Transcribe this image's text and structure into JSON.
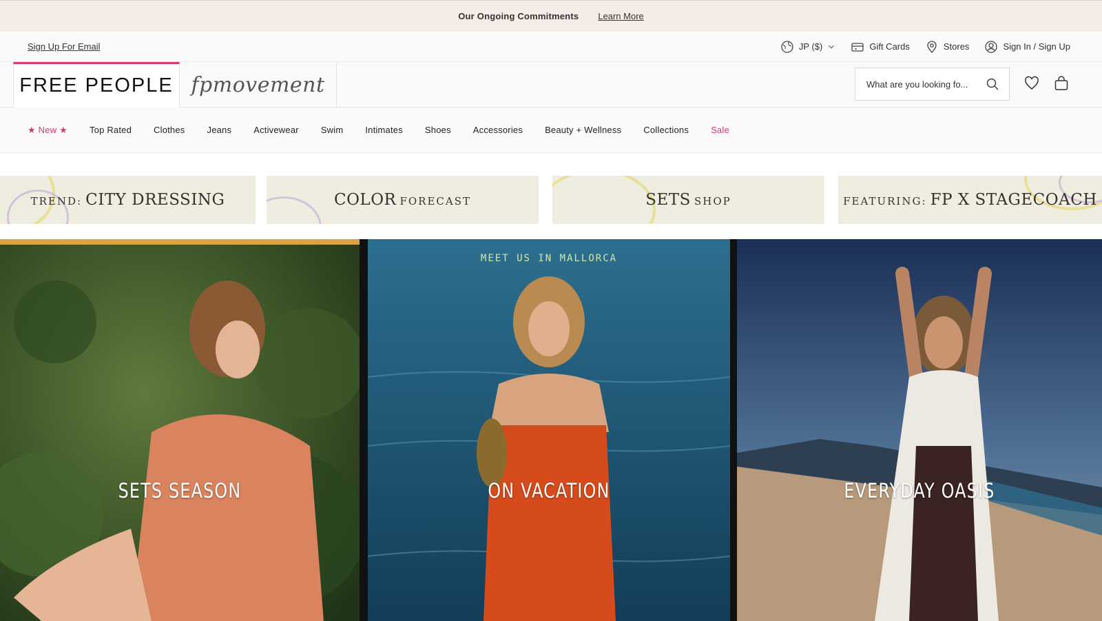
{
  "announcement": {
    "message": "Our Ongoing Commitments",
    "link": "Learn More"
  },
  "utility": {
    "email_signup": "Sign Up For Email",
    "region": "JP ($)",
    "gift_cards": "Gift Cards",
    "stores": "Stores",
    "account": "Sign In / Sign Up"
  },
  "brands": {
    "main": "FREE PEOPLE",
    "secondary": "fpmovement"
  },
  "search": {
    "placeholder": "What are you looking fo..."
  },
  "nav": {
    "items": [
      "New",
      "Top Rated",
      "Clothes",
      "Jeans",
      "Activewear",
      "Swim",
      "Intimates",
      "Shoes",
      "Accessories",
      "Beauty + Wellness",
      "Collections",
      "Sale"
    ]
  },
  "promos": [
    {
      "prefix": "TREND:",
      "title": "CITY DRESSING"
    },
    {
      "title": "COLOR",
      "suffix": "FORECAST"
    },
    {
      "title": "SETS",
      "suffix": "SHOP"
    },
    {
      "prefix": "FEATURING:",
      "title": "FP X STAGECOACH"
    }
  ],
  "heroes": [
    {
      "caption": "SETS SEASON"
    },
    {
      "kicker": "MEET US IN MALLORCA",
      "caption": "ON VACATION"
    },
    {
      "caption": "EVERYDAY OASIS"
    }
  ],
  "colors": {
    "accent_pink": "#d63a72",
    "announce_bg": "#f5ece7",
    "promo_bg": "#efece0"
  }
}
